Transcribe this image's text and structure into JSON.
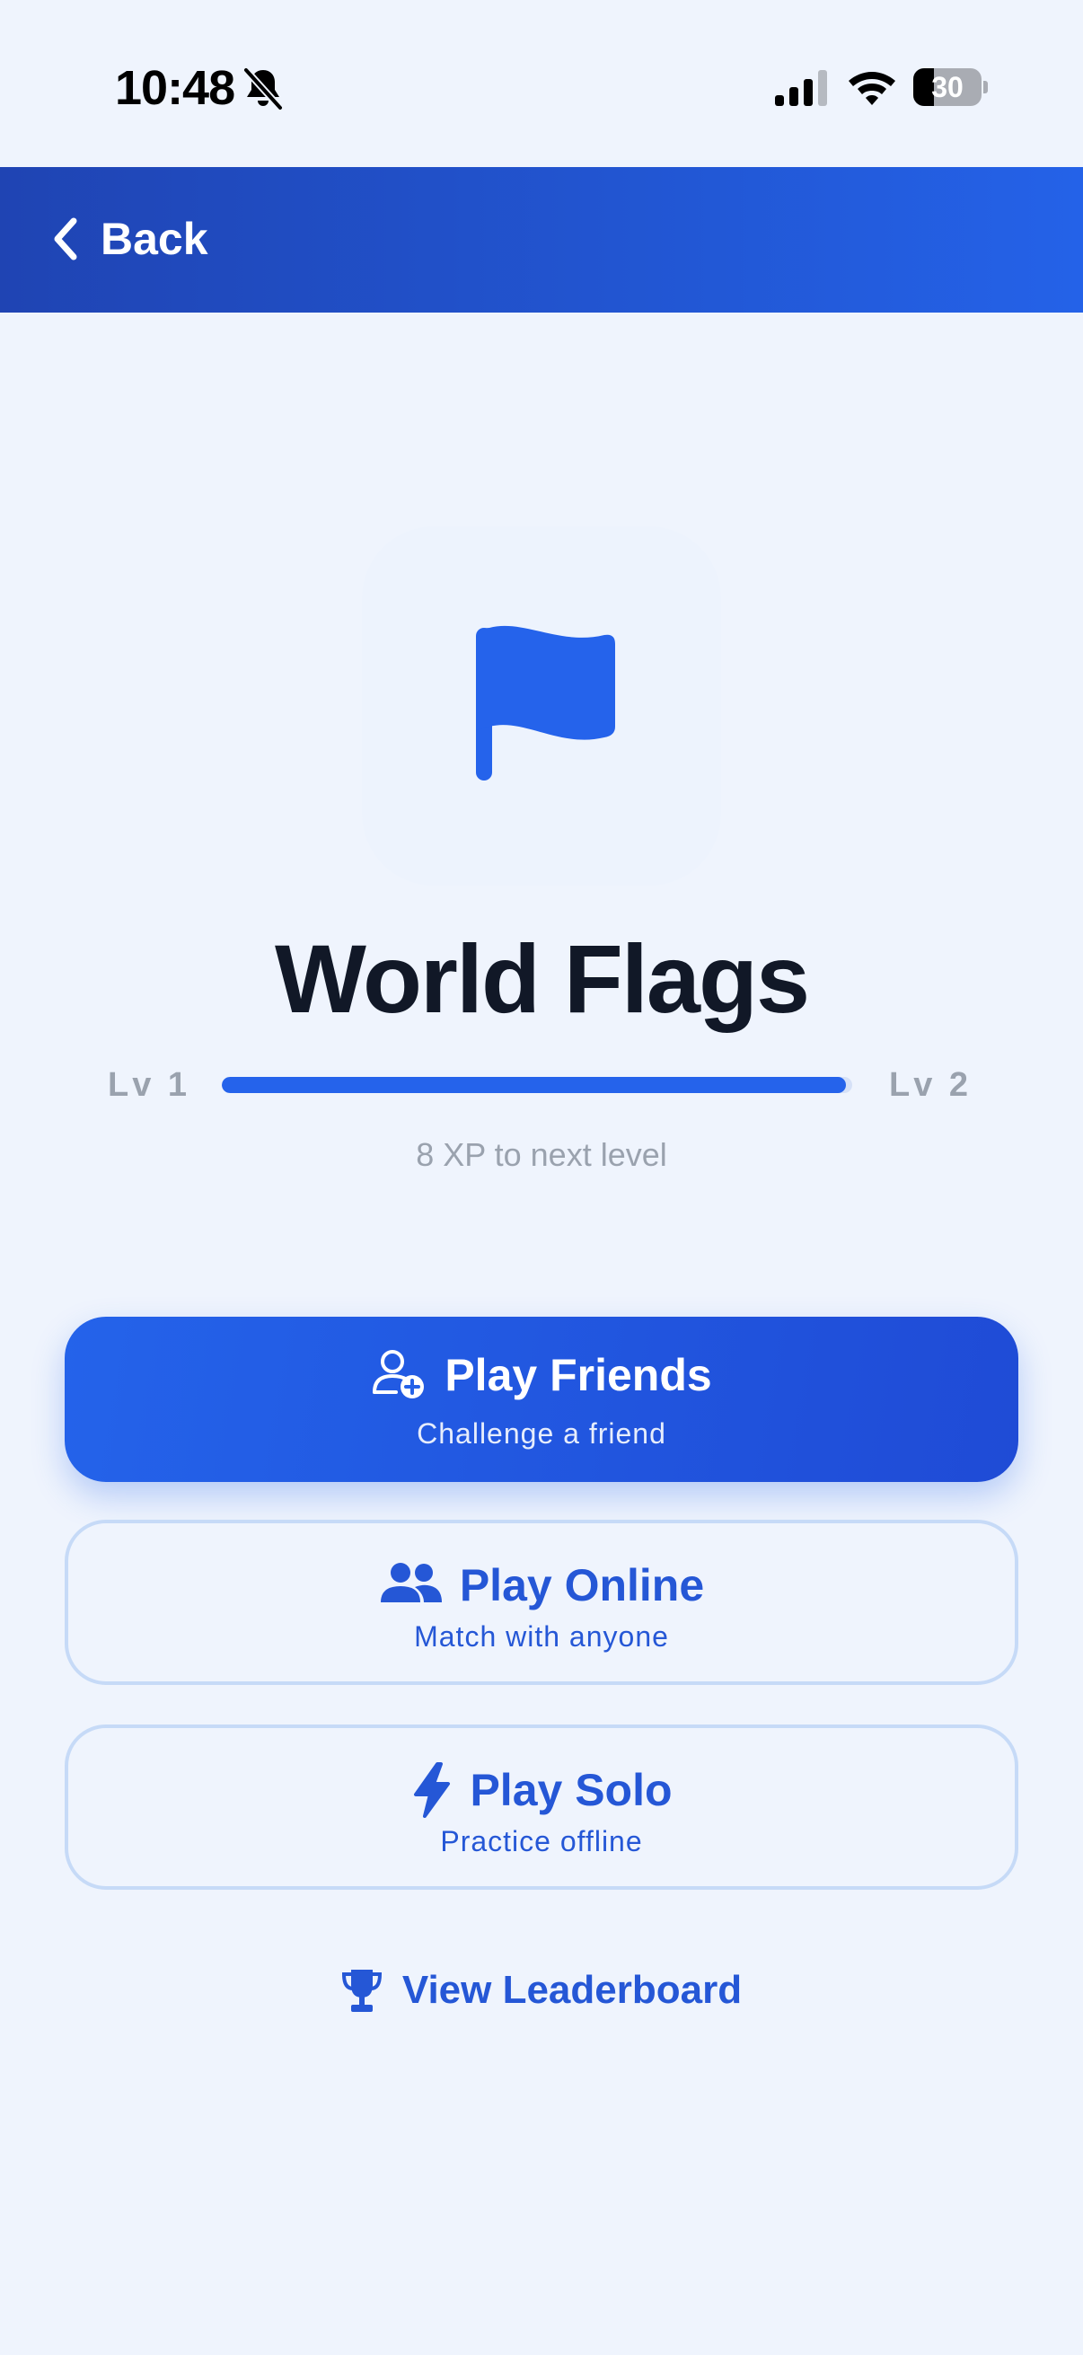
{
  "status_bar": {
    "time": "10:48",
    "battery_level": "30",
    "icons": [
      "bell-slash-icon",
      "cellular-signal-icon",
      "wifi-icon",
      "battery-icon"
    ]
  },
  "header": {
    "back_label": "Back",
    "back_icon": "chevron-left-icon"
  },
  "game": {
    "title": "World Flags",
    "icon": "flag-icon",
    "level_current": "Lv 1",
    "level_next": "Lv 2",
    "progress_fraction": 0.99,
    "xp_text": "8 XP to next level"
  },
  "modes": [
    {
      "title": "Play Friends",
      "subtitle": "Challenge a friend",
      "icon": "user-plus-icon"
    },
    {
      "title": "Play Online",
      "subtitle": "Match with anyone",
      "icon": "users-icon"
    },
    {
      "title": "Play Solo",
      "subtitle": "Practice offline",
      "icon": "bolt-icon"
    }
  ],
  "leaderboard": {
    "label": "View Leaderboard",
    "icon": "trophy-icon"
  },
  "colors": {
    "background": "#eff4fd",
    "accent": "#2563eb",
    "header_start": "#1f44b3",
    "header_end": "#2462e8",
    "title_text": "#111827",
    "muted_text": "#9aa2ae",
    "outline_border": "#c6daf7"
  }
}
